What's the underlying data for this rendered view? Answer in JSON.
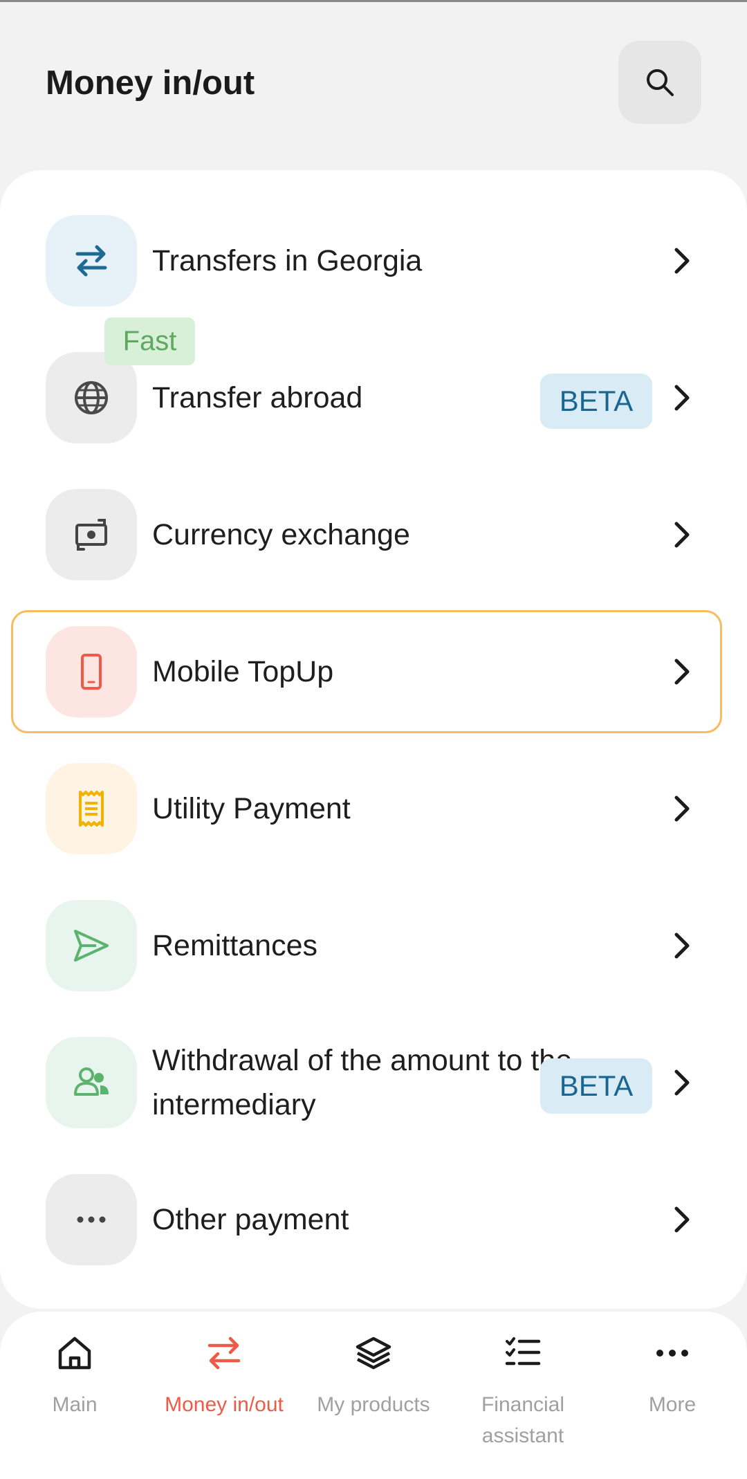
{
  "header": {
    "title": "Money in/out"
  },
  "items": [
    {
      "label": "Transfers in Georgia",
      "icon": "arrows-transfer-icon"
    },
    {
      "label": "Transfer abroad",
      "badge": "BETA",
      "tag": "Fast",
      "icon": "globe-icon"
    },
    {
      "label": "Currency exchange",
      "icon": "currency-exchange-icon"
    },
    {
      "label": "Mobile TopUp",
      "icon": "mobile-phone-icon"
    },
    {
      "label": "Utility Payment",
      "icon": "receipt-icon"
    },
    {
      "label": "Remittances",
      "icon": "send-plane-icon"
    },
    {
      "label": "Withdrawal of the amount to the intermediary",
      "badge": "BETA",
      "icon": "users-icon"
    },
    {
      "label": "Other payment",
      "icon": "more-dots-icon"
    }
  ],
  "nav": {
    "items": [
      {
        "label": "Main",
        "icon": "home-icon"
      },
      {
        "label": "Money in/out",
        "icon": "transfer-icon",
        "active": true
      },
      {
        "label": "My products",
        "icon": "layers-icon"
      },
      {
        "label": "Financial assistant",
        "icon": "checklist-icon"
      },
      {
        "label": "More",
        "icon": "more-icon"
      }
    ]
  },
  "colors": {
    "accent": "#ee5a45",
    "highlight_border": "#f6bd60",
    "beta_bg": "#d9ecf5",
    "beta_text": "#1a6691",
    "fast_bg": "#d8f0d8",
    "fast_text": "#5fa85f"
  }
}
